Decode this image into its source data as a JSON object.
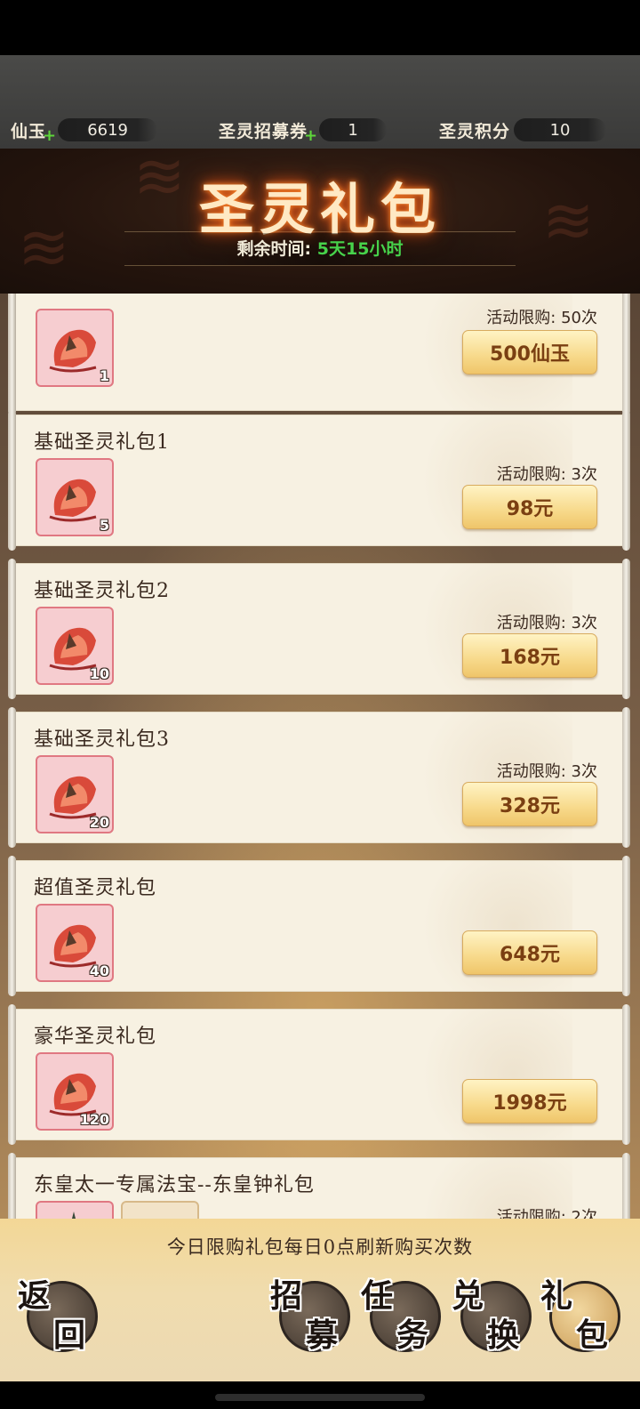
{
  "resources": [
    {
      "label": "仙玉",
      "value": "6619",
      "has_plus": true
    },
    {
      "label": "圣灵招募券",
      "value": "1",
      "has_plus": true
    },
    {
      "label": "圣灵积分",
      "value": "10",
      "has_plus": false
    }
  ],
  "banner": {
    "title": "圣灵礼包",
    "timer_label": "剩余时间:",
    "timer_value": "5天15小时"
  },
  "packs": [
    {
      "title": "",
      "count": "1",
      "limit": "活动限购: 50次",
      "price": "500仙玉"
    },
    {
      "title": "基础圣灵礼包1",
      "count": "5",
      "limit": "活动限购: 3次",
      "price": "98元"
    },
    {
      "title": "基础圣灵礼包2",
      "count": "10",
      "limit": "活动限购: 3次",
      "price": "168元"
    },
    {
      "title": "基础圣灵礼包3",
      "count": "20",
      "limit": "活动限购: 3次",
      "price": "328元"
    },
    {
      "title": "超值圣灵礼包",
      "count": "40",
      "limit": "",
      "price": "648元"
    },
    {
      "title": "豪华圣灵礼包",
      "count": "120",
      "limit": "",
      "price": "1998元"
    },
    {
      "title": "东皇太一专属法宝--东皇钟礼包",
      "count": "",
      "limit": "活动限购: 2次",
      "price": ""
    }
  ],
  "footer": {
    "notice": "今日限购礼包每日0点刷新购买次数",
    "buttons": [
      {
        "name": "back-button",
        "c1": "返",
        "c2": "回"
      },
      {
        "name": "recruit-button",
        "c1": "招",
        "c2": "募"
      },
      {
        "name": "task-button",
        "c1": "任",
        "c2": "务"
      },
      {
        "name": "exchange-button",
        "c1": "兑",
        "c2": "换"
      },
      {
        "name": "gift-button",
        "c1": "礼",
        "c2": "包"
      }
    ]
  },
  "icons": {
    "item": "red-silk-pouch-icon",
    "plus": "plus-icon"
  },
  "colors": {
    "timer_value": "#47d24b",
    "plus": "#5ed63a",
    "price_text": "#7a3f12",
    "card_bg": "#f7f1e2"
  }
}
